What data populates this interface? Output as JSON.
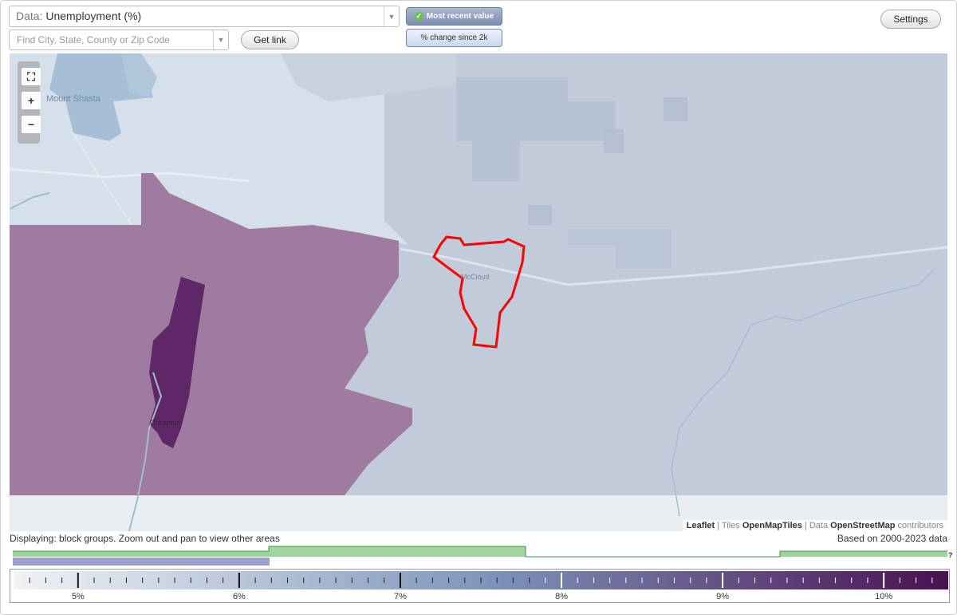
{
  "controls": {
    "data_prefix": "Data:",
    "data_value": "Unemployment (%)",
    "search_placeholder": "Find City, State, County or Zip Code",
    "get_link": "Get link",
    "settings": "Settings",
    "mode_recent": "Most recent value",
    "mode_change": "% change since 2k"
  },
  "map": {
    "labels": [
      "Mount Shasta",
      "McCloud",
      "Dunsmuir"
    ],
    "zoom_in": "+",
    "zoom_out": "−",
    "attribution": {
      "leaflet": "Leaflet",
      "tiles_pre": "Tiles",
      "tiles": "OpenMapTiles",
      "data_pre": "Data",
      "osm": "OpenStreetMap",
      "contributors": "contributors"
    },
    "colors": {
      "low": "#d9e6ee",
      "mid": "#9b7ba0",
      "high": "#5e2766",
      "selection": "#ff0000"
    }
  },
  "status": {
    "displaying": "Displaying: block groups. Zoom out and pan to view other areas",
    "based_on": "Based on 2000-2023 data"
  },
  "histogram": {
    "unknown_mark": "?",
    "colors": {
      "bars": "#9fd39f",
      "line": "#4a8c4a",
      "selected_range": "#9e9ecd"
    }
  },
  "legend": {
    "ticks": [
      "5%",
      "6%",
      "7%",
      "8%",
      "9%",
      "10%"
    ],
    "scale_min": 4.6,
    "scale_max": 10.4,
    "colors": {
      "start": "#f1f3f5",
      "middle": "#7e97bb",
      "end": "#4a1050"
    }
  }
}
